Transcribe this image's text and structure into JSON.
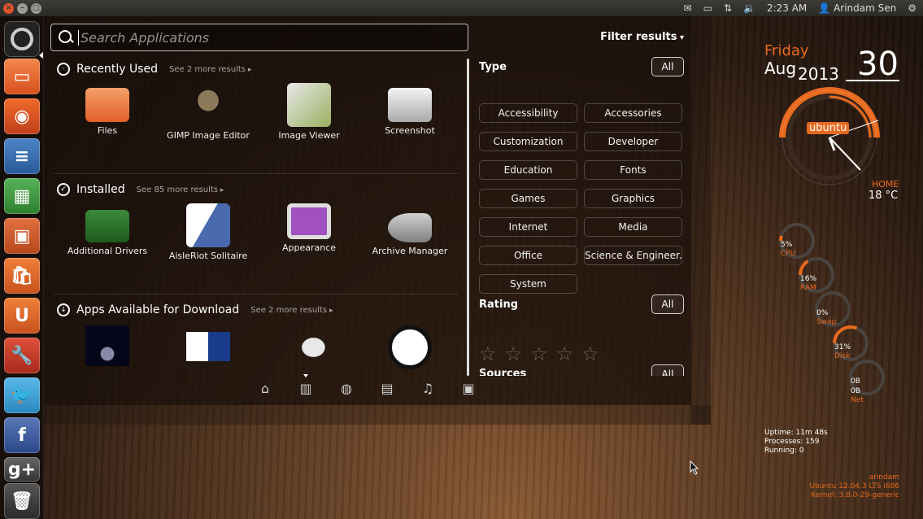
{
  "top_panel": {
    "clock": "2:23 AM",
    "user": "Arindam Sen",
    "window_buttons": [
      "close",
      "minimize",
      "maximize"
    ],
    "indicators": [
      "mail-icon",
      "battery-icon",
      "network-icon",
      "volume-icon",
      "gear-icon"
    ]
  },
  "launcher": {
    "items": [
      {
        "name": "dash-home",
        "color": "#222222"
      },
      {
        "name": "files",
        "color": "#e2622a"
      },
      {
        "name": "firefox",
        "color": "#e2622a"
      },
      {
        "name": "libreoffice-writer",
        "color": "#3a6fb0"
      },
      {
        "name": "libreoffice-calc",
        "color": "#3f9b41"
      },
      {
        "name": "libreoffice-impress",
        "color": "#c8522c"
      },
      {
        "name": "ubuntu-software-center",
        "color": "#e2622a"
      },
      {
        "name": "ubuntu-one",
        "color": "#e2622a"
      },
      {
        "name": "system-settings",
        "color": "#c33b2d"
      },
      {
        "name": "twitter",
        "color": "#3fa3d8"
      },
      {
        "name": "facebook",
        "color": "#3b5998"
      },
      {
        "name": "google-plus",
        "color": "#555555"
      },
      {
        "name": "trash",
        "color": "#444444"
      }
    ]
  },
  "search": {
    "placeholder": "Search Applications"
  },
  "categories": {
    "recent": {
      "title": "Recently Used",
      "more": "See 2 more results",
      "apps": [
        {
          "label": "Files",
          "icon": "files-icon"
        },
        {
          "label": "GIMP Image Editor",
          "icon": "gimp-icon"
        },
        {
          "label": "Image Viewer",
          "icon": "image-viewer-icon"
        },
        {
          "label": "Screenshot",
          "icon": "camera-icon"
        }
      ]
    },
    "installed": {
      "title": "Installed",
      "more": "See 85 more results",
      "apps": [
        {
          "label": "Additional Drivers",
          "icon": "drivers-icon"
        },
        {
          "label": "AisleRiot Solitaire",
          "icon": "cards-icon"
        },
        {
          "label": "Appearance",
          "icon": "monitor-icon"
        },
        {
          "label": "Archive Manager",
          "icon": "archive-icon"
        }
      ]
    },
    "download": {
      "title": "Apps Available for Download",
      "more": "See 2 more results",
      "apps": [
        {
          "label": "",
          "icon": "space-game-icon"
        },
        {
          "label": "",
          "icon": "flags-icon"
        },
        {
          "label": "",
          "icon": "mouse-icon"
        },
        {
          "label": "",
          "icon": "logo-circle-icon"
        }
      ]
    }
  },
  "lenses": [
    "home-lens",
    "applications-lens",
    "social-lens",
    "files-lens",
    "music-lens",
    "video-lens"
  ],
  "filters": {
    "title": "Filter results",
    "type_title": "Type",
    "all_label": "All",
    "types": [
      "Accessibility",
      "Accessories",
      "Customization",
      "Developer",
      "Education",
      "Fonts",
      "Games",
      "Graphics",
      "Internet",
      "Media",
      "Office",
      "Science & Engineer...",
      "System"
    ],
    "rating_title": "Rating",
    "sources_title": "Sources",
    "star_glyph": "☆"
  },
  "conky": {
    "day": "Friday",
    "month": "Aug",
    "year": "2013",
    "date": "30",
    "badge": "ubuntu",
    "home_label": "HOME",
    "temperature": "18 °C",
    "gauges": [
      {
        "value": "5%",
        "label": "CPU"
      },
      {
        "value": "16%",
        "label": "RAM"
      },
      {
        "value": "0%",
        "label": "Swap"
      },
      {
        "value": "31%",
        "label": "Disk"
      },
      {
        "value": "0B",
        "label": ""
      },
      {
        "value": "0B",
        "label": "Net"
      }
    ],
    "uptime": "Uptime: 11m 48s",
    "processes": "Processes: 159",
    "running": "Running: 0",
    "user": "arindam",
    "os": "Ubuntu 12.04.3 LTS  i686",
    "kernel": "Kernel: 3.8.0-29-generic"
  },
  "colors": {
    "accent": "#e86a1e"
  }
}
